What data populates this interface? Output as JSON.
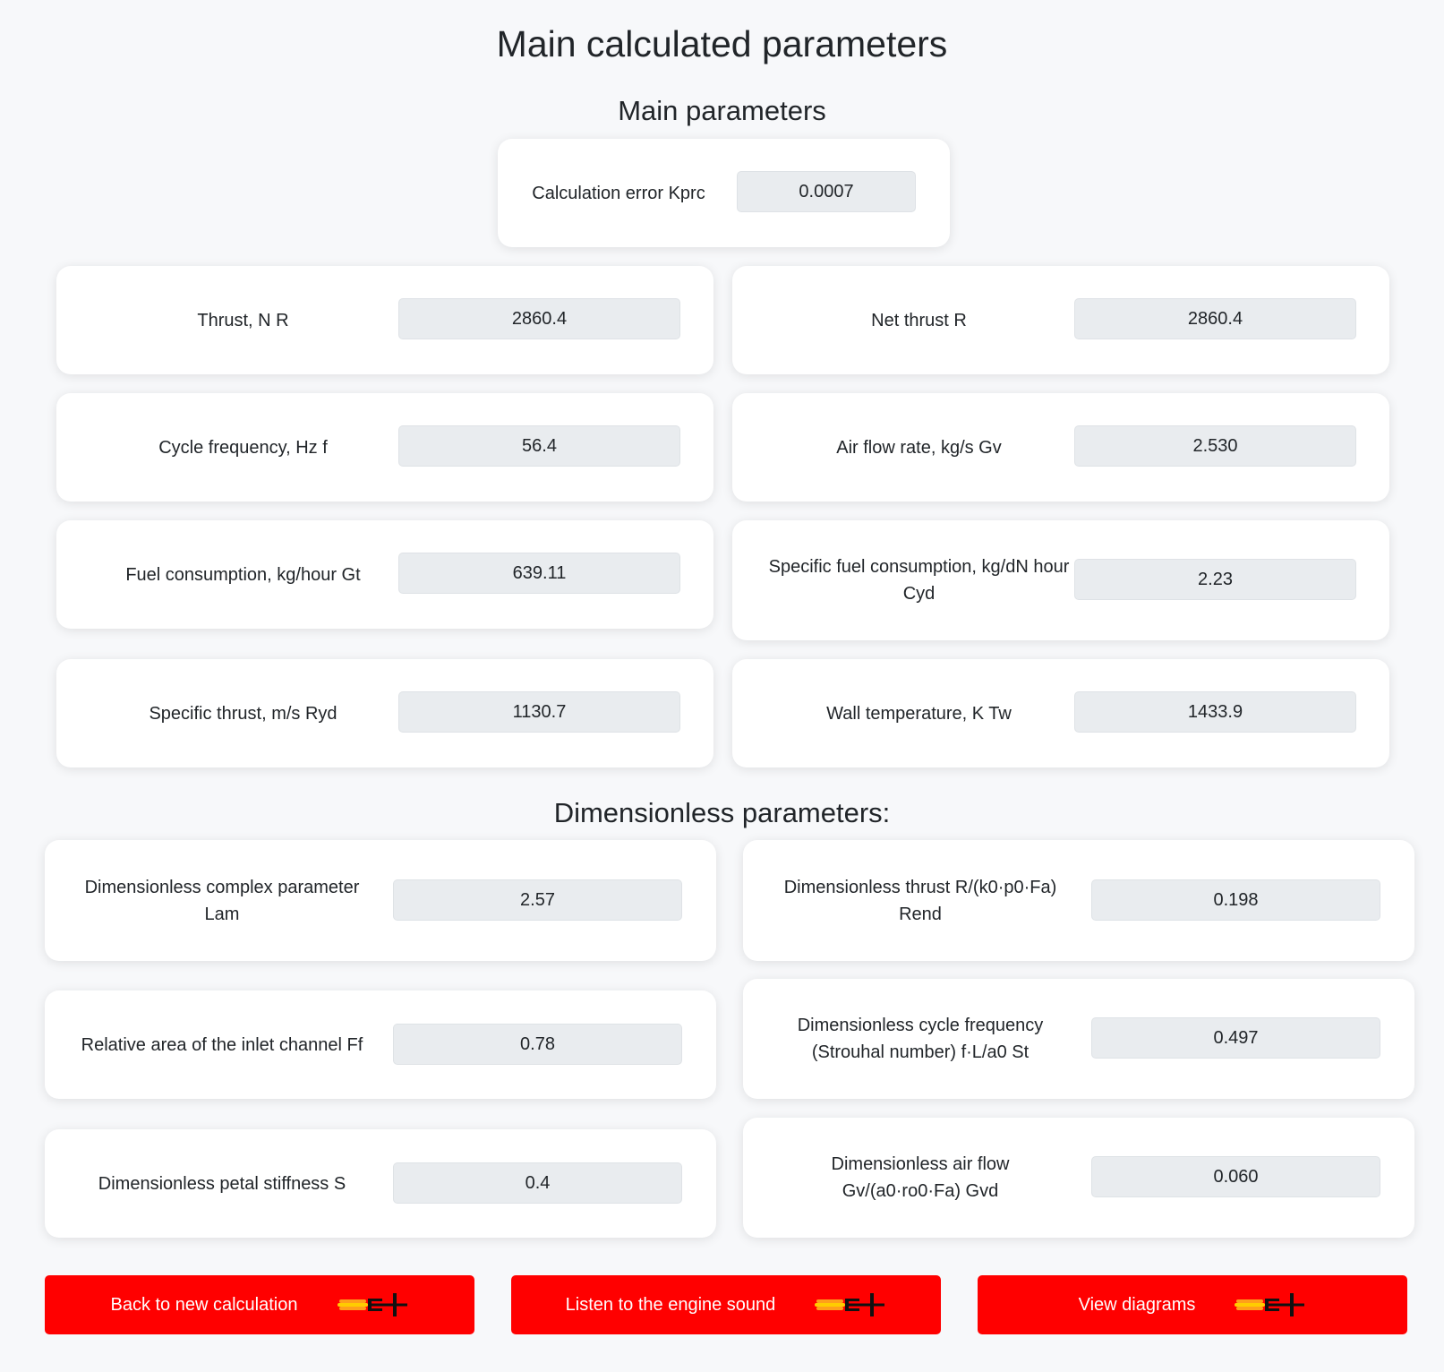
{
  "page_title": "Main calculated parameters",
  "main_section": {
    "title": "Main parameters",
    "error": {
      "label": "Calculation error Kprc",
      "value": "0.0007"
    },
    "params": [
      {
        "label": "Thrust, N R",
        "value": "2860.4"
      },
      {
        "label": "Net thrust R",
        "value": "2860.4"
      },
      {
        "label": "Cycle frequency, Hz f",
        "value": "56.4"
      },
      {
        "label": "Air flow rate, kg/s Gv",
        "value": "2.530"
      },
      {
        "label": "Fuel consumption, kg/hour Gt",
        "value": "639.11"
      },
      {
        "label": "Specific fuel consumption, kg/dN hour Cyd",
        "value": "2.23"
      },
      {
        "label": "Specific thrust, m/s Ryd",
        "value": "1130.7"
      },
      {
        "label": "Wall temperature, K Tw",
        "value": "1433.9"
      }
    ]
  },
  "dimensionless_section": {
    "title": "Dimensionless parameters:",
    "params": [
      {
        "label": "Dimensionless complex parameter Lam",
        "value": "2.57"
      },
      {
        "label": "Dimensionless thrust R/(k0·p0·Fa) Rend",
        "value": "0.198"
      },
      {
        "label": "Relative area of the inlet channel Ff",
        "value": "0.78"
      },
      {
        "label": "Dimensionless cycle frequency (Strouhal number) f·L/a0 St",
        "value": "0.497"
      },
      {
        "label": "Dimensionless petal stiffness S",
        "value": "0.4"
      },
      {
        "label": "Dimensionless air flow Gv/(a0·ro0·Fa) Gvd",
        "value": "0.060"
      }
    ]
  },
  "buttons": {
    "back": "Back to new calculation",
    "listen": "Listen to the engine sound",
    "diagrams": "View diagrams",
    "icon": "rocket-engine-icon"
  }
}
